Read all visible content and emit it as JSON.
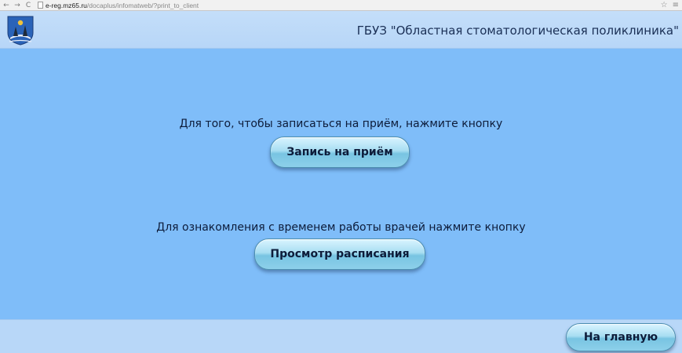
{
  "browser": {
    "url_host": "e-reg.mz65.ru",
    "url_path": "/docaplus/infomatweb/?print_to_client",
    "back_glyph": "←",
    "forward_glyph": "→",
    "reload_glyph": "C",
    "star_glyph": "☆",
    "menu_glyph": "≡"
  },
  "header": {
    "title": "ГБУЗ \"Областная стоматологическая поликлиника\""
  },
  "main": {
    "appointment_prompt": "Для того, чтобы записаться на приём, нажмите кнопку",
    "appointment_button": "Запись на приём",
    "schedule_prompt": "Для ознакомления с временем работы врачей нажмите кнопку",
    "schedule_button": "Просмотр расписания"
  },
  "footer": {
    "home_button": "На главную"
  },
  "colors": {
    "background": "#7fbdf9",
    "header": "#c4def9",
    "text": "#0d1c3a"
  }
}
